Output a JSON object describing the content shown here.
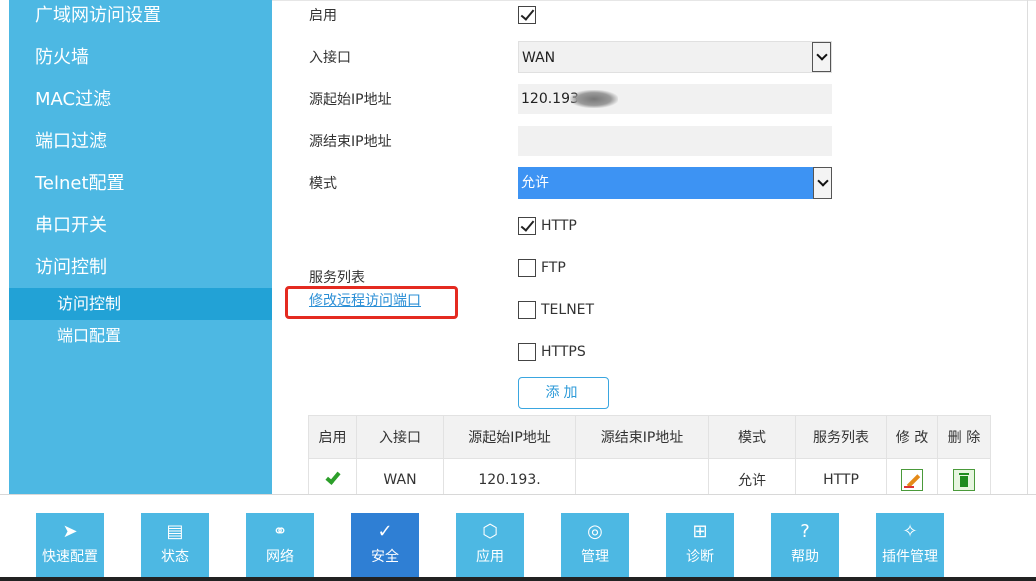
{
  "sidebar": {
    "items": [
      {
        "label": "广域网访问设置"
      },
      {
        "label": "防火墙"
      },
      {
        "label": "MAC过滤"
      },
      {
        "label": "端口过滤"
      },
      {
        "label": "Telnet配置"
      },
      {
        "label": "串口开关"
      },
      {
        "label": "访问控制"
      }
    ],
    "subitems": [
      {
        "label": "访问控制",
        "active": true
      },
      {
        "label": "端口配置",
        "active": false
      }
    ]
  },
  "form": {
    "enable_label": "启用",
    "enable_checked": true,
    "interface_label": "入接口",
    "interface_value": "WAN",
    "src_start_label": "源起始IP地址",
    "src_start_value": "120.193.",
    "src_end_label": "源结束IP地址",
    "src_end_value": "",
    "mode_label": "模式",
    "mode_value": "允许",
    "services_label": "服务列表",
    "services": [
      {
        "label": "HTTP",
        "checked": true
      },
      {
        "label": "FTP",
        "checked": false
      },
      {
        "label": "TELNET",
        "checked": false
      },
      {
        "label": "HTTPS",
        "checked": false
      }
    ],
    "remote_port_link": "修改远程访问端口",
    "add_button": "添加"
  },
  "table": {
    "headers": [
      "启用",
      "入接口",
      "源起始IP地址",
      "源结束IP地址",
      "模式",
      "服务列表",
      "修 改",
      "删 除"
    ],
    "rows": [
      {
        "enabled": true,
        "interface": "WAN",
        "src_start": "120.193.",
        "src_end": "",
        "mode": "允许",
        "services": "HTTP"
      }
    ]
  },
  "bottom_nav": [
    {
      "label": "快速配置",
      "icon": "send-icon"
    },
    {
      "label": "状态",
      "icon": "clipboard-icon"
    },
    {
      "label": "网络",
      "icon": "globe-icon"
    },
    {
      "label": "安全",
      "icon": "shield-icon",
      "active": true
    },
    {
      "label": "应用",
      "icon": "box-icon"
    },
    {
      "label": "管理",
      "icon": "settings-icon"
    },
    {
      "label": "诊断",
      "icon": "medkit-icon"
    },
    {
      "label": "帮助",
      "icon": "help-icon"
    },
    {
      "label": "插件管理",
      "icon": "plugin-icon"
    }
  ],
  "colors": {
    "sidebar": "#4db8e3",
    "sidebar_active": "#22a2d6",
    "nav_active": "#2f7fd4",
    "highlight_box": "#e42a20",
    "mode_select": "#3d93f3"
  }
}
